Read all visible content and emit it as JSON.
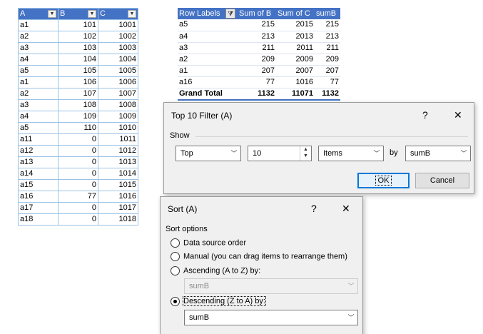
{
  "left_table": {
    "headers": [
      "A",
      "B",
      "C"
    ],
    "rows": [
      [
        "a1",
        "101",
        "1001"
      ],
      [
        "a2",
        "102",
        "1002"
      ],
      [
        "a3",
        "103",
        "1003"
      ],
      [
        "a4",
        "104",
        "1004"
      ],
      [
        "a5",
        "105",
        "1005"
      ],
      [
        "a1",
        "106",
        "1006"
      ],
      [
        "a2",
        "107",
        "1007"
      ],
      [
        "a3",
        "108",
        "1008"
      ],
      [
        "a4",
        "109",
        "1009"
      ],
      [
        "a5",
        "110",
        "1010"
      ],
      [
        "a11",
        "0",
        "1011"
      ],
      [
        "a12",
        "0",
        "1012"
      ],
      [
        "a13",
        "0",
        "1013"
      ],
      [
        "a14",
        "0",
        "1014"
      ],
      [
        "a15",
        "0",
        "1015"
      ],
      [
        "a16",
        "77",
        "1016"
      ],
      [
        "a17",
        "0",
        "1017"
      ],
      [
        "a18",
        "0",
        "1018"
      ]
    ]
  },
  "pivot": {
    "headers": [
      "Row Labels",
      "Sum of B",
      "Sum of C",
      "sumB"
    ],
    "rows": [
      [
        "a5",
        "215",
        "2015",
        "215"
      ],
      [
        "a4",
        "213",
        "2013",
        "213"
      ],
      [
        "a3",
        "211",
        "2011",
        "211"
      ],
      [
        "a2",
        "209",
        "2009",
        "209"
      ],
      [
        "a1",
        "207",
        "2007",
        "207"
      ],
      [
        "a16",
        "77",
        "1016",
        "77"
      ]
    ],
    "total": [
      "Grand Total",
      "1132",
      "11071",
      "1132"
    ]
  },
  "top10_dialog": {
    "title": "Top 10 Filter (A)",
    "help": "?",
    "close": "✕",
    "show_label": "Show",
    "mode": "Top",
    "count": "10",
    "unit": "Items",
    "by_label": "by",
    "by_field": "sumB",
    "ok": "OK",
    "cancel": "Cancel"
  },
  "sort_dialog": {
    "title": "Sort (A)",
    "help": "?",
    "close": "✕",
    "section_label": "Sort options",
    "opt_data_source": "Data source order",
    "opt_manual": "Manual (you can drag items to rearrange them)",
    "opt_ascending": "Ascending (A to Z) by:",
    "ascending_field": "sumB",
    "opt_descending": "Descending (Z to A) by:",
    "descending_field": "sumB"
  },
  "colors": {
    "header_blue": "#4472c4",
    "grid_blue": "#9bc2e6",
    "dialog_bg": "#f0f0f0",
    "focus_blue": "#0078d7"
  },
  "icons": {
    "filter": "filter-dropdown-icon",
    "sort_filter": "sort-filter-icon",
    "help": "help-icon",
    "close": "close-icon",
    "dropdown": "chevron-down-icon",
    "spin": "spin-updown-icon"
  }
}
